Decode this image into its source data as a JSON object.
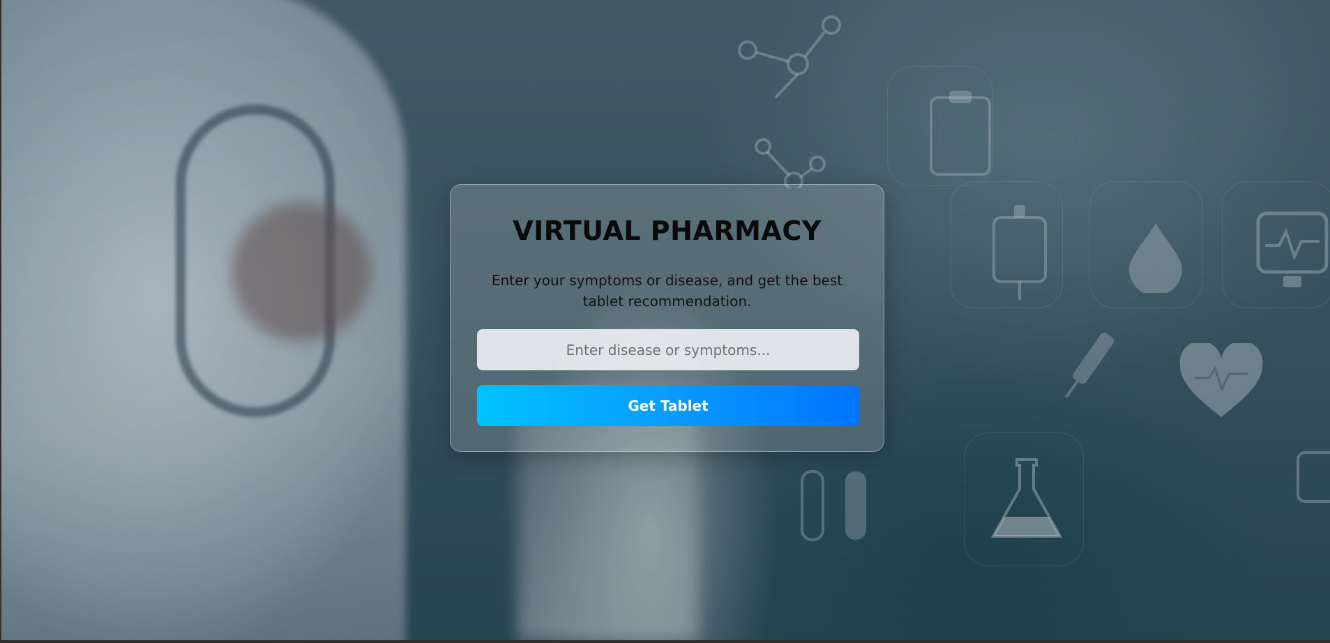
{
  "header": {
    "title": "VIRTUAL PHARMACY",
    "subtitle": "Enter your symptoms or disease, and get the best tablet recommendation."
  },
  "form": {
    "search_placeholder": "Enter disease or symptoms...",
    "search_value": "",
    "submit_label": "Get Tablet"
  },
  "background": {
    "description_icons": [
      "molecule-icon",
      "clipboard-icon",
      "iv-bag-icon",
      "blood-drop-icon",
      "ecg-monitor-icon",
      "syringe-icon",
      "heart-icon",
      "flask-icon",
      "test-tubes-icon"
    ]
  },
  "colors": {
    "button_start": "#00c2ff",
    "button_end": "#0074ff",
    "title": "#0a0a0a"
  }
}
